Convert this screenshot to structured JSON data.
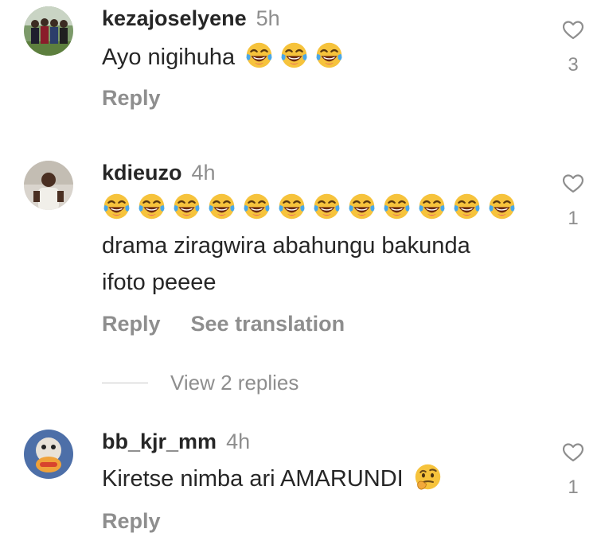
{
  "comments": [
    {
      "username": "kezajoselyene",
      "time": "5h",
      "text": "Ayo nigihuha",
      "emoji_icon": "face-with-tears-of-joy-icon",
      "emoji_count": 3,
      "reply_label": "Reply",
      "like_count": "3"
    },
    {
      "username": "kdieuzo",
      "time": "4h",
      "emoji_icon": "face-with-tears-of-joy-icon",
      "emoji_count": 12,
      "text_line1": "drama ziragwira abahungu bakunda",
      "text_line2": "ifoto peeee",
      "reply_label": "Reply",
      "translate_label": "See translation",
      "like_count": "1",
      "view_replies_label": "View 2 replies"
    },
    {
      "username": "bb_kjr_mm",
      "time": "4h",
      "text": "Kiretse nimba ari AMARUNDI",
      "emoji_icon": "thinking-face-icon",
      "reply_label": "Reply",
      "like_count": "1"
    }
  ],
  "colors": {
    "primary_text": "#262626",
    "secondary_text": "#8e8e8e",
    "divider": "#c7c7c7"
  }
}
